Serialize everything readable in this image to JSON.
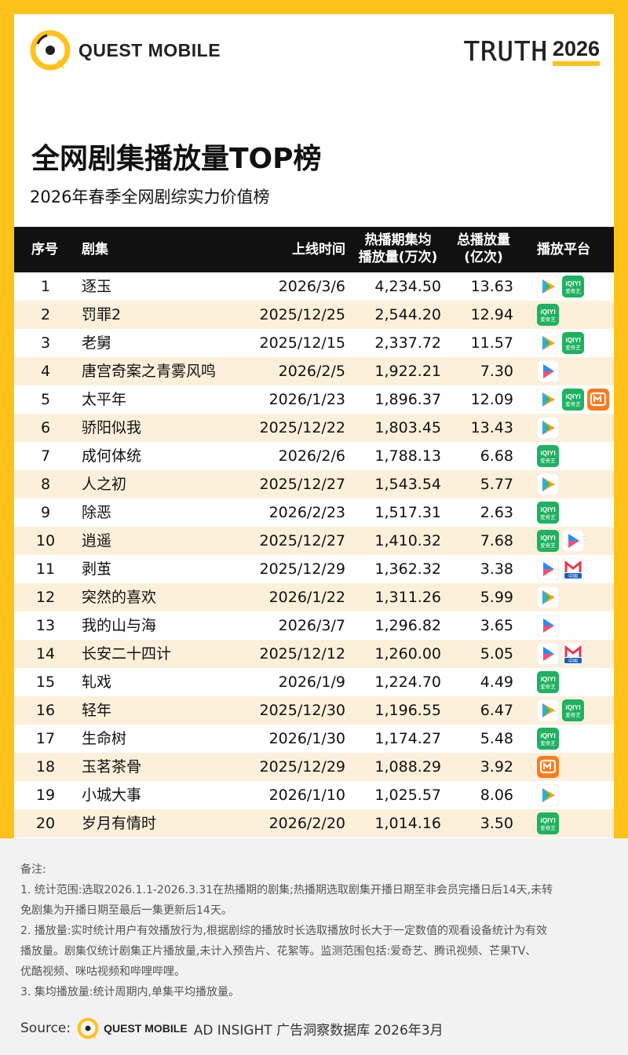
{
  "brand": {
    "name": "QUEST MOBILE",
    "truth_word": "TRUTH",
    "truth_year": "2026"
  },
  "title": "全网剧集播放量TOP榜",
  "subtitle": "2026年春季全网剧综实力价值榜",
  "colors": {
    "accent": "#FFC21A",
    "header_bg": "#111111",
    "row_alt": "#FDF0DB"
  },
  "chart_data": {
    "type": "table",
    "columns": [
      "序号",
      "剧集",
      "上线时间",
      "热播期集均\n播放量(万次)",
      "总播放量\n(亿次)",
      "播放平台"
    ],
    "rows": [
      {
        "rank": "1",
        "name": "逐玉",
        "date": "2026/3/6",
        "avg": "4,234.50",
        "total": "13.63",
        "platforms": [
          "tencent-video-icon",
          "iqiyi-icon"
        ]
      },
      {
        "rank": "2",
        "name": "罚罪2",
        "date": "2025/12/25",
        "avg": "2,544.20",
        "total": "12.94",
        "platforms": [
          "iqiyi-icon"
        ]
      },
      {
        "rank": "3",
        "name": "老舅",
        "date": "2025/12/15",
        "avg": "2,337.72",
        "total": "11.57",
        "platforms": [
          "tencent-video-icon",
          "iqiyi-icon"
        ]
      },
      {
        "rank": "4",
        "name": "唐宫奇案之青雾风鸣",
        "date": "2026/2/5",
        "avg": "1,922.21",
        "total": "7.30",
        "platforms": [
          "youku-icon"
        ]
      },
      {
        "rank": "5",
        "name": "太平年",
        "date": "2026/1/23",
        "avg": "1,896.37",
        "total": "12.09",
        "platforms": [
          "tencent-video-icon",
          "iqiyi-icon",
          "mgtv-icon"
        ]
      },
      {
        "rank": "6",
        "name": "骄阳似我",
        "date": "2025/12/22",
        "avg": "1,803.45",
        "total": "13.43",
        "platforms": [
          "tencent-video-icon"
        ]
      },
      {
        "rank": "7",
        "name": "成何体统",
        "date": "2026/2/6",
        "avg": "1,788.13",
        "total": "6.68",
        "platforms": [
          "iqiyi-icon"
        ]
      },
      {
        "rank": "8",
        "name": "人之初",
        "date": "2025/12/27",
        "avg": "1,543.54",
        "total": "5.77",
        "platforms": [
          "tencent-video-icon"
        ]
      },
      {
        "rank": "9",
        "name": "除恶",
        "date": "2026/2/23",
        "avg": "1,517.31",
        "total": "2.63",
        "platforms": [
          "iqiyi-icon"
        ]
      },
      {
        "rank": "10",
        "name": "逍遥",
        "date": "2025/12/27",
        "avg": "1,410.32",
        "total": "7.68",
        "platforms": [
          "iqiyi-icon",
          "youku-icon"
        ]
      },
      {
        "rank": "11",
        "name": "剥茧",
        "date": "2025/12/29",
        "avg": "1,362.32",
        "total": "3.38",
        "platforms": [
          "youku-icon",
          "migu-icon"
        ]
      },
      {
        "rank": "12",
        "name": "突然的喜欢",
        "date": "2026/1/22",
        "avg": "1,311.26",
        "total": "5.99",
        "platforms": [
          "tencent-video-icon"
        ]
      },
      {
        "rank": "13",
        "name": "我的山与海",
        "date": "2026/3/7",
        "avg": "1,296.82",
        "total": "3.65",
        "platforms": [
          "youku-icon"
        ]
      },
      {
        "rank": "14",
        "name": "长安二十四计",
        "date": "2025/12/12",
        "avg": "1,260.00",
        "total": "5.05",
        "platforms": [
          "youku-icon",
          "migu-icon"
        ]
      },
      {
        "rank": "15",
        "name": "轧戏",
        "date": "2026/1/9",
        "avg": "1,224.70",
        "total": "4.49",
        "platforms": [
          "iqiyi-icon"
        ]
      },
      {
        "rank": "16",
        "name": "轻年",
        "date": "2025/12/30",
        "avg": "1,196.55",
        "total": "6.47",
        "platforms": [
          "tencent-video-icon",
          "iqiyi-icon"
        ]
      },
      {
        "rank": "17",
        "name": "生命树",
        "date": "2026/1/30",
        "avg": "1,174.27",
        "total": "5.48",
        "platforms": [
          "iqiyi-icon"
        ]
      },
      {
        "rank": "18",
        "name": "玉茗茶骨",
        "date": "2025/12/29",
        "avg": "1,088.29",
        "total": "3.92",
        "platforms": [
          "mgtv-icon"
        ]
      },
      {
        "rank": "19",
        "name": "小城大事",
        "date": "2026/1/10",
        "avg": "1,025.57",
        "total": "8.06",
        "platforms": [
          "tencent-video-icon"
        ]
      },
      {
        "rank": "20",
        "name": "岁月有情时",
        "date": "2026/2/20",
        "avg": "1,014.16",
        "total": "3.50",
        "platforms": [
          "iqiyi-icon"
        ]
      }
    ]
  },
  "header": {
    "rank": "序号",
    "name": "剧集",
    "date": "上线时间",
    "avg_line1": "热播期集均",
    "avg_line2": "播放量(万次)",
    "total_line1": "总播放量",
    "total_line2": "(亿次)",
    "platform": "播放平台"
  },
  "platform_labels": {
    "iqiyi_top": "iQIYI",
    "iqiyi_bottom": "爱奇艺",
    "migu_bottom": "中国"
  },
  "notes": [
    "备注:",
    "1. 统计范围:选取2026.1.1-2026.3.31在热播期的剧集;热播期选取剧集开播日期至非会员完播日后14天,未转",
    "免剧集为开播日期至最后一集更新后14天。",
    "2. 播放量:实时统计用户有效播放行为,根据剧综的播放时长选取播放时长大于一定数值的观看设备统计为有效",
    "播放量。剧集仅统计剧集正片播放量,未计入预告片、花絮等。监测范围包括:爱奇艺、腾讯视频、芒果TV、",
    "优酷视频、咪咕视频和哔哩哔哩。",
    "3. 集均播放量:统计周期内,单集平均播放量。"
  ],
  "source": {
    "label": "Source:",
    "brand": "QUEST MOBILE",
    "db": "AD INSIGHT 广告洞察数据库 2026年3月"
  }
}
